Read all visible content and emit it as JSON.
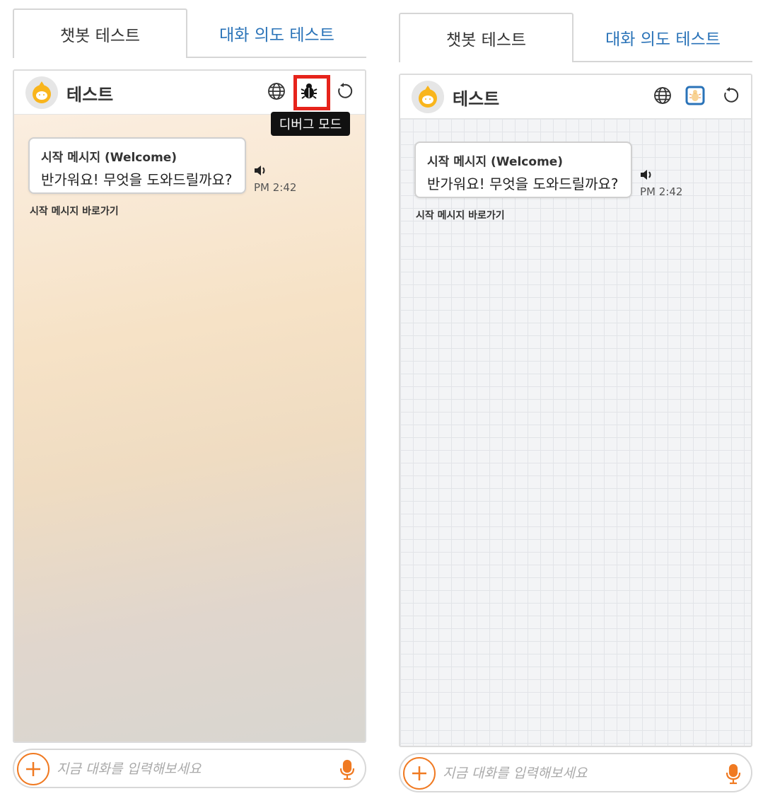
{
  "tabs": {
    "active": "챗봇 테스트",
    "inactive": "대화 의도 테스트"
  },
  "chat": {
    "title": "테스트",
    "tooltip": "디버그 모드",
    "message_label": "시작 메시지 (Welcome)",
    "message_text": "반가워요! 무엇을 도와드릴까요?",
    "time": "PM 2:42",
    "shortcut": "시작 메시지 바로가기"
  },
  "input": {
    "placeholder": "지금 대화를 입력해보세요"
  },
  "colors": {
    "accent": "#f07a22",
    "link": "#2a73b8",
    "highlight": "#e6231b",
    "debug_active": "#2a73b8"
  },
  "icons": [
    "globe-icon",
    "bug-icon",
    "reset-icon",
    "speaker-icon",
    "plus-icon",
    "mic-icon"
  ]
}
